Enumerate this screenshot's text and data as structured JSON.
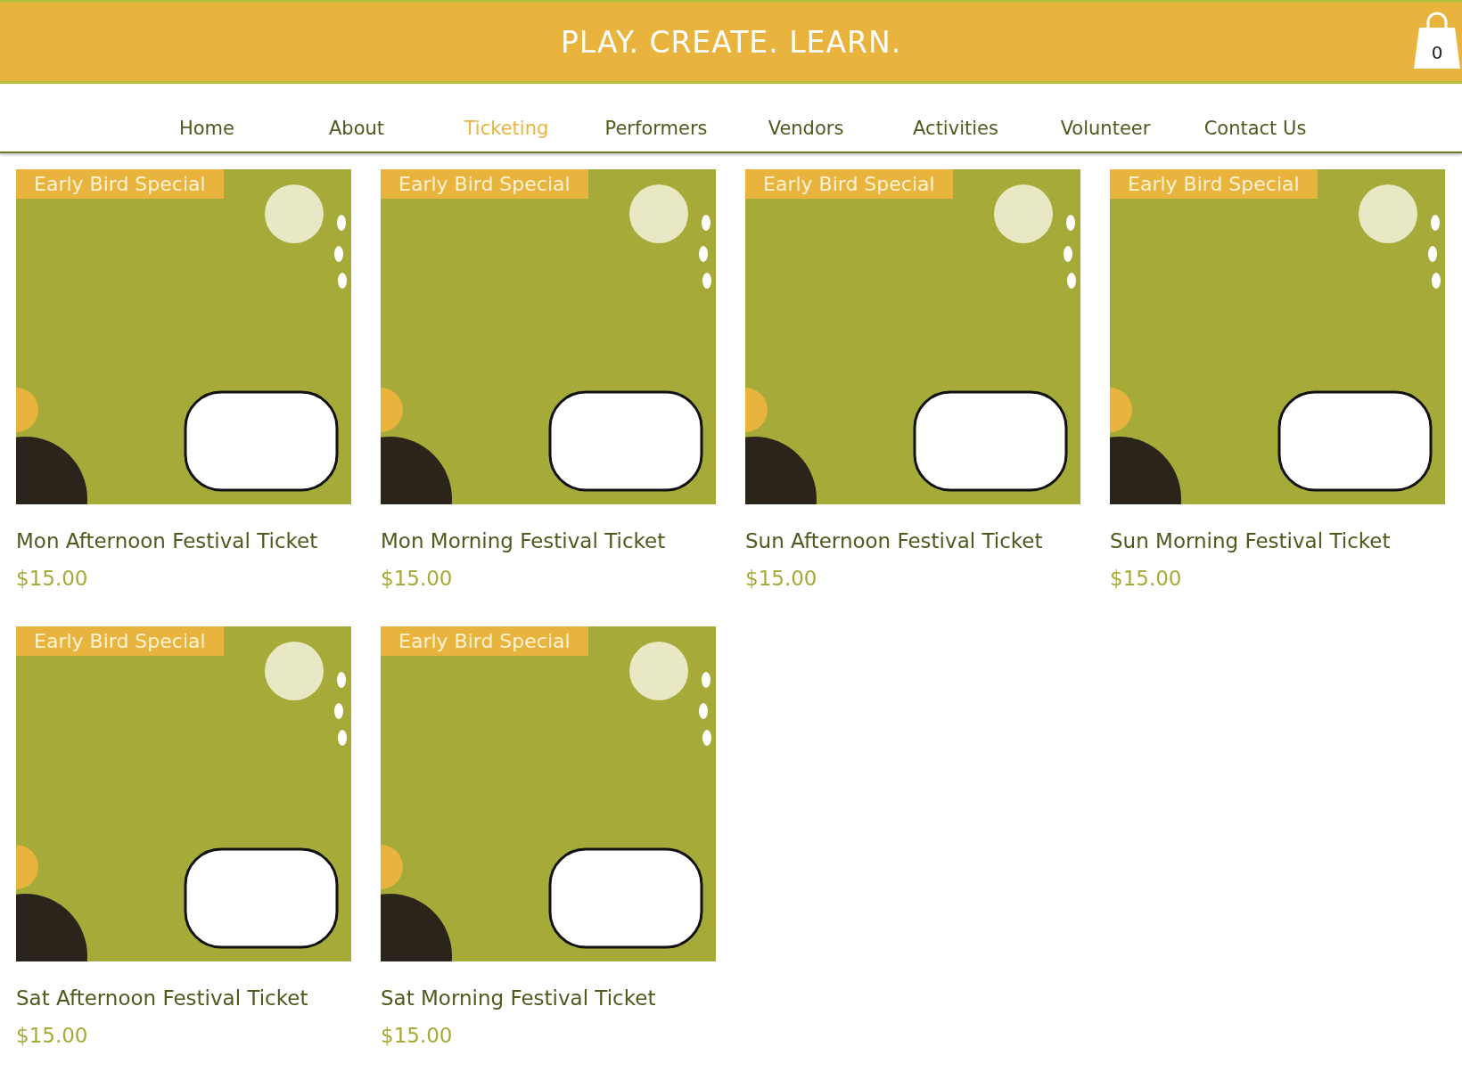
{
  "header": {
    "title": "PLAY. CREATE. LEARN.",
    "cart": {
      "count": "0"
    }
  },
  "nav": [
    {
      "label": "Home",
      "selected": false
    },
    {
      "label": "About",
      "selected": false
    },
    {
      "label": "Ticketing",
      "selected": true
    },
    {
      "label": "Performers",
      "selected": false
    },
    {
      "label": "Vendors",
      "selected": false
    },
    {
      "label": "Activities",
      "selected": false
    },
    {
      "label": "Volunteer",
      "selected": false
    },
    {
      "label": "Contact Us",
      "selected": false
    }
  ],
  "products": [
    {
      "ribbon": "Early Bird Special",
      "name": "Mon Afternoon Festival Ticket",
      "price": "$15.00"
    },
    {
      "ribbon": "Early Bird Special",
      "name": "Mon Morning Festival Ticket",
      "price": "$15.00"
    },
    {
      "ribbon": "Early Bird Special",
      "name": "Sun Afternoon Festival Ticket",
      "price": "$15.00"
    },
    {
      "ribbon": "Early Bird Special",
      "name": "Sun Morning Festival Ticket",
      "price": "$15.00"
    },
    {
      "ribbon": "Early Bird Special",
      "name": "Sat Afternoon Festival Ticket",
      "price": "$15.00"
    },
    {
      "ribbon": "Early Bird Special",
      "name": "Sat Morning Festival Ticket",
      "price": "$15.00"
    }
  ]
}
